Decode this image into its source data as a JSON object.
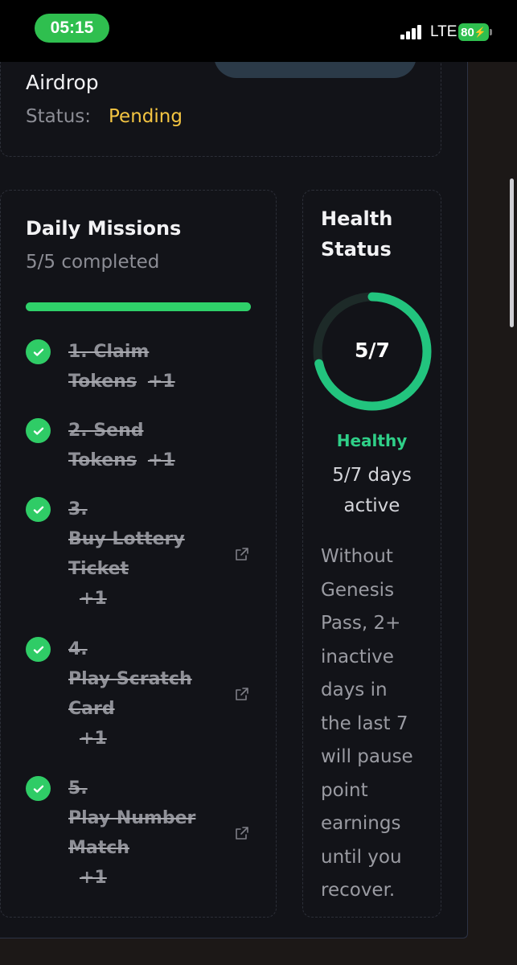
{
  "status_bar": {
    "time": "05:15",
    "network": "LTE",
    "battery": "80"
  },
  "airdrop": {
    "title": "Airdrop",
    "status_label": "Status:",
    "status_value": "Pending",
    "status_color": "#f4c542"
  },
  "missions": {
    "title": "Daily Missions",
    "progress_text": "5/5 completed",
    "progress": 1.0,
    "items": [
      {
        "lines": [
          "1. Claim",
          "Tokens"
        ],
        "points": "+1",
        "external": false
      },
      {
        "lines": [
          "2. Send",
          "Tokens"
        ],
        "points": "+1",
        "external": false
      },
      {
        "lines": [
          "3.",
          "Buy Lottery",
          "Ticket"
        ],
        "points": "+1",
        "external": true
      },
      {
        "lines": [
          "4.",
          "Play Scratch",
          "Card"
        ],
        "points": "+1",
        "external": true
      },
      {
        "lines": [
          "5.",
          "Play Number",
          "Match"
        ],
        "points": "+1",
        "external": true
      }
    ]
  },
  "health": {
    "title_line1": "Health",
    "title_line2": "Status",
    "score": "5/7",
    "ratio": 0.714,
    "state": "Healthy",
    "days_line1": "5/7 days",
    "days_line2": "active",
    "note_lines": [
      "Without",
      "Genesis",
      "Pass, 2+",
      "inactive",
      "days in",
      "the last 7",
      "will pause",
      "point",
      "earnings",
      "until you",
      "recover."
    ]
  },
  "colors": {
    "accent_green": "#2fd16a",
    "ring_green": "#22c47e",
    "background": "#121318"
  },
  "icons": [
    "check-icon",
    "external-link-icon",
    "signal-icon",
    "battery-icon"
  ]
}
